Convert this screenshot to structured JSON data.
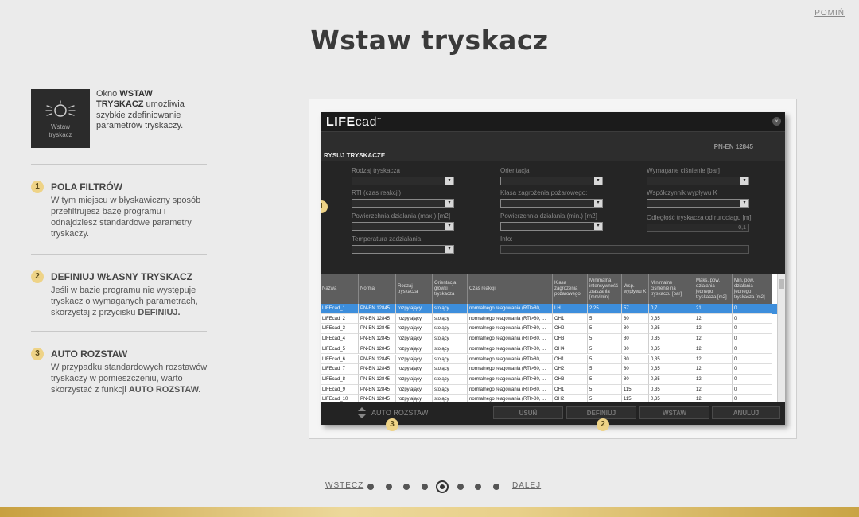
{
  "skip_label": "POMIŃ",
  "page_title": "Wstaw tryskacz",
  "intro": {
    "icon_label": "Wstaw tryskacz",
    "text_before": "Okno ",
    "text_bold": "WSTAW TRYSKACZ",
    "text_after": " umożliwia szybkie zdefiniowanie parametrów tryskaczy."
  },
  "steps": [
    {
      "number": "1",
      "title": "POLA FILTRÓW",
      "body": "W tym miejscu w błyskawiczny sposób przefiltrujesz bazę programu i odnajdziesz standardowe parametry tryskaczy.",
      "body_bold": ""
    },
    {
      "number": "2",
      "title": "DEFINIUJ WŁASNY TRYSKACZ",
      "body": "Jeśli w bazie programu nie występuje tryskacz o wymaganych parametrach, skorzystaj z przycisku ",
      "body_bold": "DEFINIUJ."
    },
    {
      "number": "3",
      "title": "AUTO ROZSTAW",
      "body": "W przypadku standardowych rozstawów tryskaczy w pomieszczeniu, warto skorzystać z funkcji ",
      "body_bold": "AUTO ROZSTAW."
    }
  ],
  "app": {
    "logo_bold": "LIFE",
    "logo_rest": "cad",
    "logo_tm": "™",
    "close_icon": "×",
    "section_title": "RYSUJ TRYSKACZE",
    "norm": "PN-EN 12845",
    "filters": {
      "rodzaj": "Rodzaj tryskacza",
      "orientacja": "Orientacja",
      "cisnienie": "Wymagane ciśnienie [bar]",
      "rti": "RTI (czas reakcji)",
      "klasa": "Klasa zagrożenia pożarowego:",
      "wspolczynnik": "Współczynnik wypływu K",
      "pow_max": "Powierzchnia działania (max.) [m2]",
      "pow_min": "Powierzchnia działania (min.) [m2]",
      "odleglosc": "Odległość tryskacza od rurociągu [m]",
      "odleglosc_value": "0,1",
      "temperatura": "Temperatura zadziałania",
      "info": "Info:"
    },
    "columns": [
      "Nazwa",
      "Norma",
      "Rodzaj tryskacza",
      "Orientacja główki tryskacza",
      "Czas reakcji",
      "Klasa zagrożenia pożarowego",
      "Minimalna intensywność zraszania [mm/min]",
      "Wsp. wypływu K",
      "Minimalne ciśnienie na tryskaczu [bar]",
      "Maks. pow. działania jednego tryskacza [m2]",
      "Min. pow. działania jednego tryskacza [m2]"
    ],
    "rows": [
      [
        "LIFEcad_1",
        "PN-EN 12845",
        "rozpylający",
        "stojący",
        "normalnego reagowania (RTI>80, ...",
        "LH",
        "2,25",
        "57",
        "0,7",
        "21",
        "0"
      ],
      [
        "LIFEcad_2",
        "PN-EN 12845",
        "rozpylający",
        "stojący",
        "normalnego reagowania (RTI>80, ...",
        "OH1",
        "5",
        "80",
        "0,35",
        "12",
        "0"
      ],
      [
        "LIFEcad_3",
        "PN-EN 12845",
        "rozpylający",
        "stojący",
        "normalnego reagowania (RTI>80, ...",
        "OH2",
        "5",
        "80",
        "0,35",
        "12",
        "0"
      ],
      [
        "LIFEcad_4",
        "PN-EN 12845",
        "rozpylający",
        "stojący",
        "normalnego reagowania (RTI>80, ...",
        "OH3",
        "5",
        "80",
        "0,35",
        "12",
        "0"
      ],
      [
        "LIFEcad_5",
        "PN-EN 12845",
        "rozpylający",
        "stojący",
        "normalnego reagowania (RTI>80, ...",
        "OH4",
        "5",
        "80",
        "0,35",
        "12",
        "0"
      ],
      [
        "LIFEcad_6",
        "PN-EN 12845",
        "rozpylający",
        "stojący",
        "normalnego reagowania (RTI>80, ...",
        "OH1",
        "5",
        "80",
        "0,35",
        "12",
        "0"
      ],
      [
        "LIFEcad_7",
        "PN-EN 12845",
        "rozpylający",
        "stojący",
        "normalnego reagowania (RTI>80, ...",
        "OH2",
        "5",
        "80",
        "0,35",
        "12",
        "0"
      ],
      [
        "LIFEcad_8",
        "PN-EN 12845",
        "rozpylający",
        "stojący",
        "normalnego reagowania (RTI>80, ...",
        "OH3",
        "5",
        "80",
        "0,35",
        "12",
        "0"
      ],
      [
        "LIFEcad_9",
        "PN-EN 12845",
        "rozpylający",
        "stojący",
        "normalnego reagowania (RTI>80, ...",
        "OH1",
        "5",
        "115",
        "0,35",
        "12",
        "0"
      ],
      [
        "LIFEcad_10",
        "PN-EN 12845",
        "rozpylający",
        "stojący",
        "normalnego reagowania (RTI>80, ...",
        "OH2",
        "5",
        "115",
        "0,35",
        "12",
        "0"
      ]
    ],
    "selected_row": 0,
    "footer": {
      "auto": "AUTO ROZSTAW",
      "usun": "USUŃ",
      "definiuj": "DEFINIUJ",
      "wstaw": "WSTAW",
      "anuluj": "ANULUJ"
    }
  },
  "nav": {
    "prev": "WSTECZ",
    "next": "DALEJ",
    "total_pages": 8,
    "current_page": 5
  },
  "colors": {
    "badge": "#eed387",
    "selected_row": "#3d8edc",
    "gold_bar": "#d9b865"
  }
}
